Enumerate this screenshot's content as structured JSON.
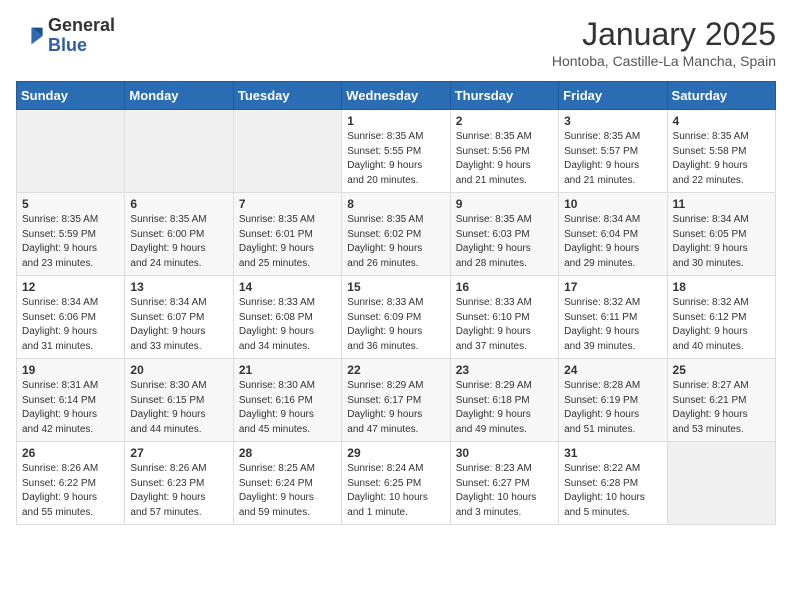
{
  "header": {
    "logo_line1": "General",
    "logo_line2": "Blue",
    "month": "January 2025",
    "location": "Hontoba, Castille-La Mancha, Spain"
  },
  "weekdays": [
    "Sunday",
    "Monday",
    "Tuesday",
    "Wednesday",
    "Thursday",
    "Friday",
    "Saturday"
  ],
  "weeks": [
    [
      {
        "day": "",
        "info": ""
      },
      {
        "day": "",
        "info": ""
      },
      {
        "day": "",
        "info": ""
      },
      {
        "day": "1",
        "info": "Sunrise: 8:35 AM\nSunset: 5:55 PM\nDaylight: 9 hours\nand 20 minutes."
      },
      {
        "day": "2",
        "info": "Sunrise: 8:35 AM\nSunset: 5:56 PM\nDaylight: 9 hours\nand 21 minutes."
      },
      {
        "day": "3",
        "info": "Sunrise: 8:35 AM\nSunset: 5:57 PM\nDaylight: 9 hours\nand 21 minutes."
      },
      {
        "day": "4",
        "info": "Sunrise: 8:35 AM\nSunset: 5:58 PM\nDaylight: 9 hours\nand 22 minutes."
      }
    ],
    [
      {
        "day": "5",
        "info": "Sunrise: 8:35 AM\nSunset: 5:59 PM\nDaylight: 9 hours\nand 23 minutes."
      },
      {
        "day": "6",
        "info": "Sunrise: 8:35 AM\nSunset: 6:00 PM\nDaylight: 9 hours\nand 24 minutes."
      },
      {
        "day": "7",
        "info": "Sunrise: 8:35 AM\nSunset: 6:01 PM\nDaylight: 9 hours\nand 25 minutes."
      },
      {
        "day": "8",
        "info": "Sunrise: 8:35 AM\nSunset: 6:02 PM\nDaylight: 9 hours\nand 26 minutes."
      },
      {
        "day": "9",
        "info": "Sunrise: 8:35 AM\nSunset: 6:03 PM\nDaylight: 9 hours\nand 28 minutes."
      },
      {
        "day": "10",
        "info": "Sunrise: 8:34 AM\nSunset: 6:04 PM\nDaylight: 9 hours\nand 29 minutes."
      },
      {
        "day": "11",
        "info": "Sunrise: 8:34 AM\nSunset: 6:05 PM\nDaylight: 9 hours\nand 30 minutes."
      }
    ],
    [
      {
        "day": "12",
        "info": "Sunrise: 8:34 AM\nSunset: 6:06 PM\nDaylight: 9 hours\nand 31 minutes."
      },
      {
        "day": "13",
        "info": "Sunrise: 8:34 AM\nSunset: 6:07 PM\nDaylight: 9 hours\nand 33 minutes."
      },
      {
        "day": "14",
        "info": "Sunrise: 8:33 AM\nSunset: 6:08 PM\nDaylight: 9 hours\nand 34 minutes."
      },
      {
        "day": "15",
        "info": "Sunrise: 8:33 AM\nSunset: 6:09 PM\nDaylight: 9 hours\nand 36 minutes."
      },
      {
        "day": "16",
        "info": "Sunrise: 8:33 AM\nSunset: 6:10 PM\nDaylight: 9 hours\nand 37 minutes."
      },
      {
        "day": "17",
        "info": "Sunrise: 8:32 AM\nSunset: 6:11 PM\nDaylight: 9 hours\nand 39 minutes."
      },
      {
        "day": "18",
        "info": "Sunrise: 8:32 AM\nSunset: 6:12 PM\nDaylight: 9 hours\nand 40 minutes."
      }
    ],
    [
      {
        "day": "19",
        "info": "Sunrise: 8:31 AM\nSunset: 6:14 PM\nDaylight: 9 hours\nand 42 minutes."
      },
      {
        "day": "20",
        "info": "Sunrise: 8:30 AM\nSunset: 6:15 PM\nDaylight: 9 hours\nand 44 minutes."
      },
      {
        "day": "21",
        "info": "Sunrise: 8:30 AM\nSunset: 6:16 PM\nDaylight: 9 hours\nand 45 minutes."
      },
      {
        "day": "22",
        "info": "Sunrise: 8:29 AM\nSunset: 6:17 PM\nDaylight: 9 hours\nand 47 minutes."
      },
      {
        "day": "23",
        "info": "Sunrise: 8:29 AM\nSunset: 6:18 PM\nDaylight: 9 hours\nand 49 minutes."
      },
      {
        "day": "24",
        "info": "Sunrise: 8:28 AM\nSunset: 6:19 PM\nDaylight: 9 hours\nand 51 minutes."
      },
      {
        "day": "25",
        "info": "Sunrise: 8:27 AM\nSunset: 6:21 PM\nDaylight: 9 hours\nand 53 minutes."
      }
    ],
    [
      {
        "day": "26",
        "info": "Sunrise: 8:26 AM\nSunset: 6:22 PM\nDaylight: 9 hours\nand 55 minutes."
      },
      {
        "day": "27",
        "info": "Sunrise: 8:26 AM\nSunset: 6:23 PM\nDaylight: 9 hours\nand 57 minutes."
      },
      {
        "day": "28",
        "info": "Sunrise: 8:25 AM\nSunset: 6:24 PM\nDaylight: 9 hours\nand 59 minutes."
      },
      {
        "day": "29",
        "info": "Sunrise: 8:24 AM\nSunset: 6:25 PM\nDaylight: 10 hours\nand 1 minute."
      },
      {
        "day": "30",
        "info": "Sunrise: 8:23 AM\nSunset: 6:27 PM\nDaylight: 10 hours\nand 3 minutes."
      },
      {
        "day": "31",
        "info": "Sunrise: 8:22 AM\nSunset: 6:28 PM\nDaylight: 10 hours\nand 5 minutes."
      },
      {
        "day": "",
        "info": ""
      }
    ]
  ]
}
